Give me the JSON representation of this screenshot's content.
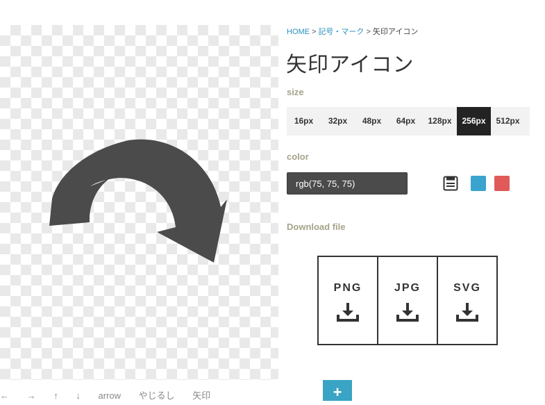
{
  "breadcrumb": {
    "home": "HOME",
    "sep1": ">",
    "category": "記号・マーク",
    "sep2": ">",
    "current": "矢印アイコン"
  },
  "page_title": "矢印アイコン",
  "size": {
    "label": "size",
    "options": [
      "16px",
      "32px",
      "48px",
      "64px",
      "128px",
      "256px",
      "512px"
    ],
    "selected": "256px"
  },
  "color": {
    "label": "color",
    "value": "rgb(75, 75, 75)",
    "icon_color": "#4b4b4b",
    "swatches": [
      "#3aa4cf",
      "#e05a5a"
    ]
  },
  "download": {
    "label": "Download file",
    "formats": [
      "PNG",
      "JPG",
      "SVG"
    ]
  },
  "tags": [
    "←",
    "→",
    "↑",
    "↓",
    "arrow",
    "やじるし",
    "矢印"
  ],
  "add_button": "+"
}
